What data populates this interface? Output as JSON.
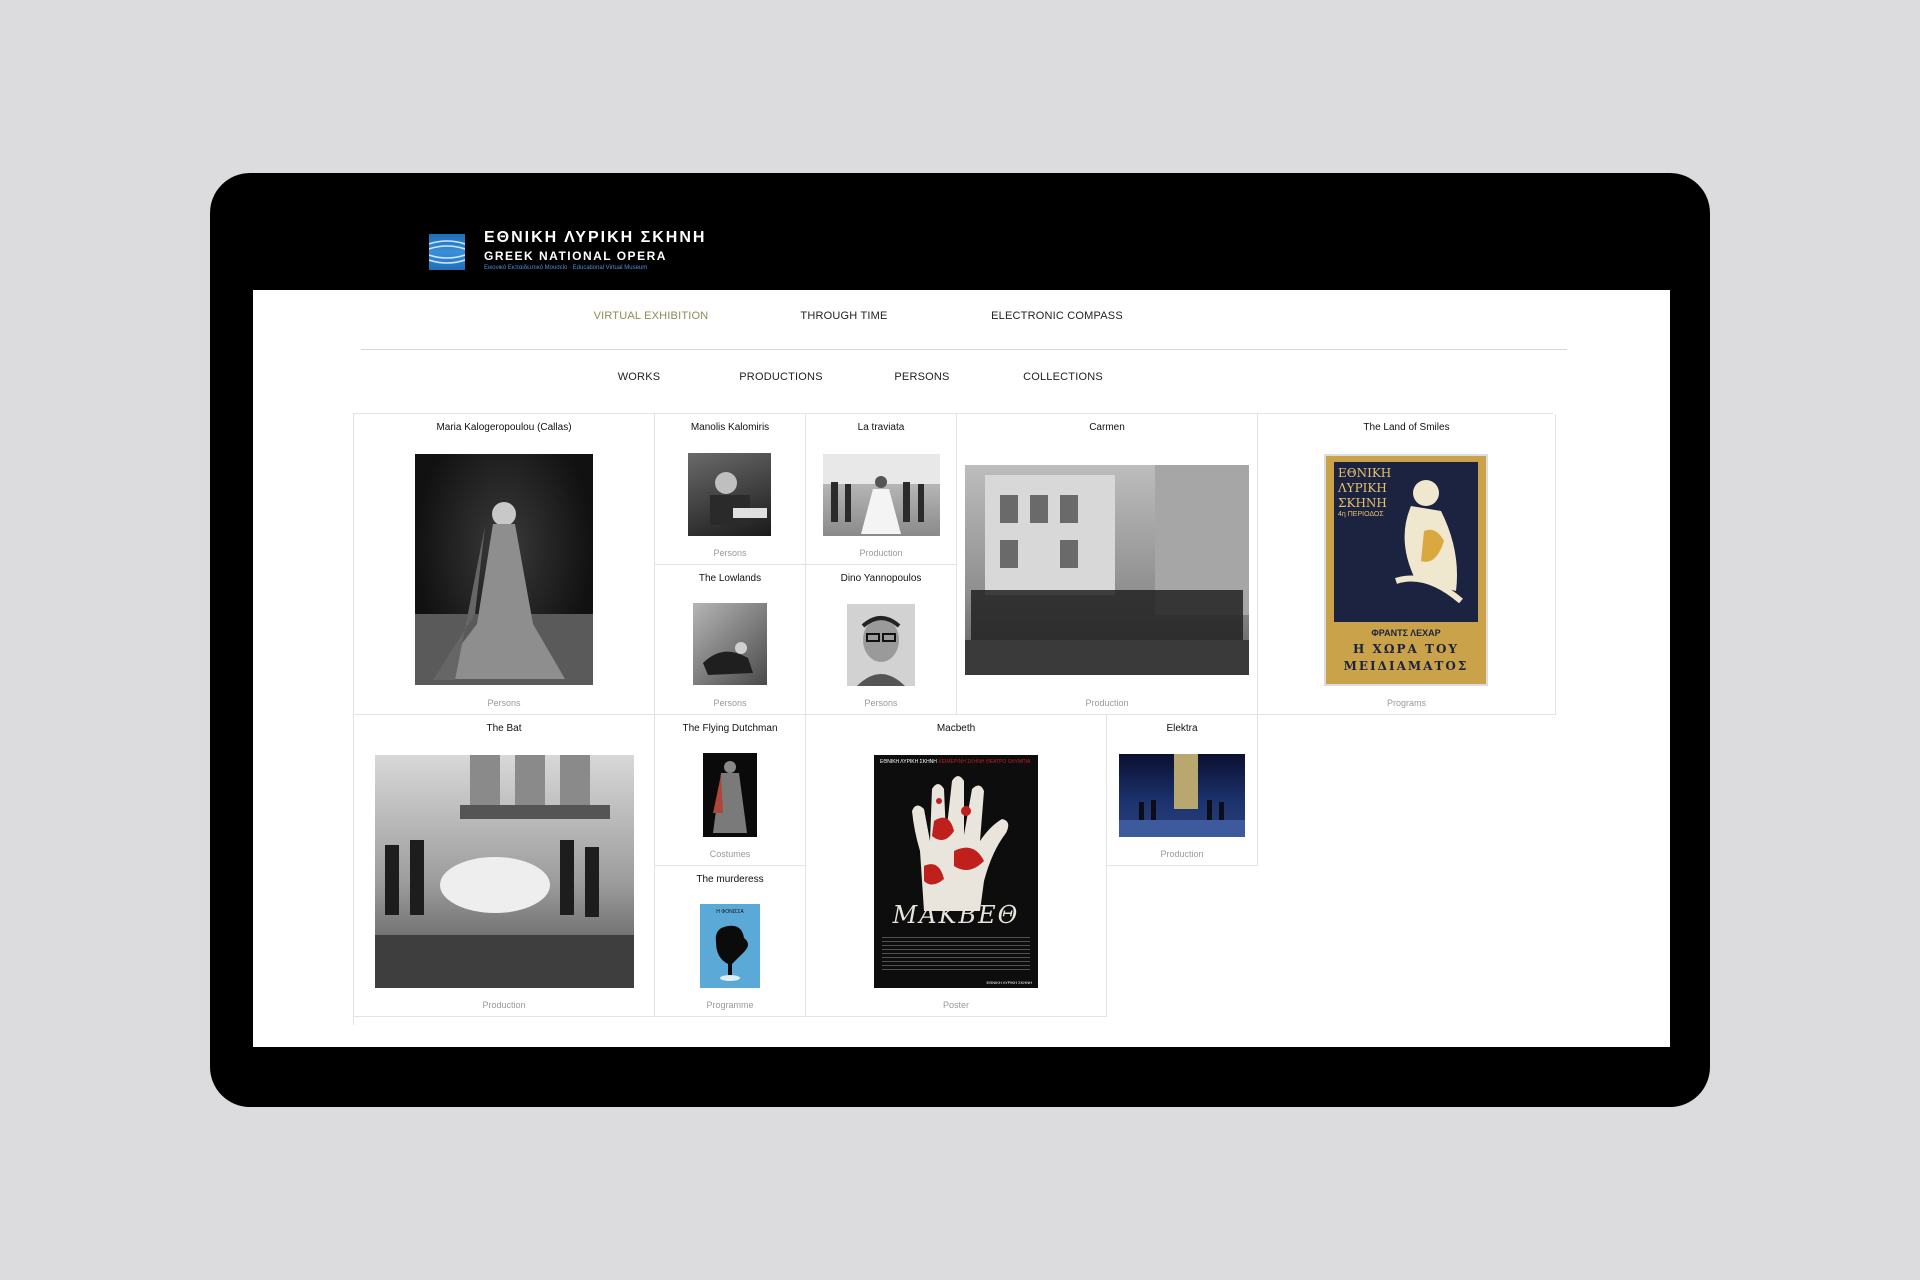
{
  "brand": {
    "title": "ΕΘΝΙΚΗ ΛΥΡΙΚΗ ΣΚΗΝΗ",
    "subtitle": "GREEK NATIONAL OPERA",
    "tagline": "Εικονικό Εκπαιδευτικό Μουσείο · Educational Virtual Museum"
  },
  "nav": {
    "main": [
      {
        "label": "VIRTUAL  EXHIBITION",
        "active": true
      },
      {
        "label": "THROUGH  TIME",
        "active": false
      },
      {
        "label": "ELECTRONIC  COMPASS",
        "active": false
      }
    ],
    "sub": [
      {
        "label": "WORKS"
      },
      {
        "label": "PRODUCTIONS"
      },
      {
        "label": "PERSONS"
      },
      {
        "label": "COLLECTIONS"
      }
    ]
  },
  "cards": [
    {
      "title": "Maria Kalogeropoulou (Callas)",
      "category": "Persons"
    },
    {
      "title": "Manolis Kalomiris",
      "category": "Persons"
    },
    {
      "title": "La traviata",
      "category": "Production"
    },
    {
      "title": "Carmen",
      "category": "Production"
    },
    {
      "title": "The Land of Smiles",
      "category": "Programs"
    },
    {
      "title": "The Lowlands",
      "category": "Persons"
    },
    {
      "title": "Dino Yannopoulos",
      "category": "Persons"
    },
    {
      "title": "The Bat",
      "category": "Production"
    },
    {
      "title": "The Flying Dutchman",
      "category": "Costumes"
    },
    {
      "title": "Macbeth",
      "category": "Poster"
    },
    {
      "title": "Elektra",
      "category": "Production"
    },
    {
      "title": "The murderess",
      "category": "Programme"
    }
  ],
  "poster_land_of_smiles": {
    "line1": "ΕΘΝΙΚΗ",
    "line2": "ΛΥΡΙΚΗ",
    "line3": "ΣΚΗΝΗ",
    "line4": "4η ΠΕΡΙΟΔΟΣ",
    "composer": "ΦΡΑΝΤΣ ΛΕΧΑΡ",
    "work1": "Η ΧΩΡΑ ΤΟΥ",
    "work2": "ΜΕΙΔΙΑΜΑΤΟΣ"
  },
  "poster_macbeth": {
    "header_white": "ΕΘΝΙΚΗ ΛΥΡΙΚΗ ΣΚΗΝΗ",
    "header_red": "ΧΕΙΜΕΡΙΝΗ ΣΚΗΝΗ ΘΕΑΤΡΟ ΟΛΥΜΠΙΑ",
    "title": "ΜΑΚΒΕΘ",
    "footer": "ΕΘΝΙΚΗ ΛΥΡΙΚΗ ΣΚΗΝΗ"
  },
  "programme_murderess": {
    "label": "Η ΦΟΝΙΣΣΑ"
  },
  "colors": {
    "backdrop": "#dcdcde",
    "bezel": "#000000",
    "nav_active": "#8c8c56",
    "logo_blue": "#1d6fb8",
    "poster_gold": "#c9a24a",
    "poster_navy": "#1c2340",
    "macbeth_red": "#c0201c"
  }
}
